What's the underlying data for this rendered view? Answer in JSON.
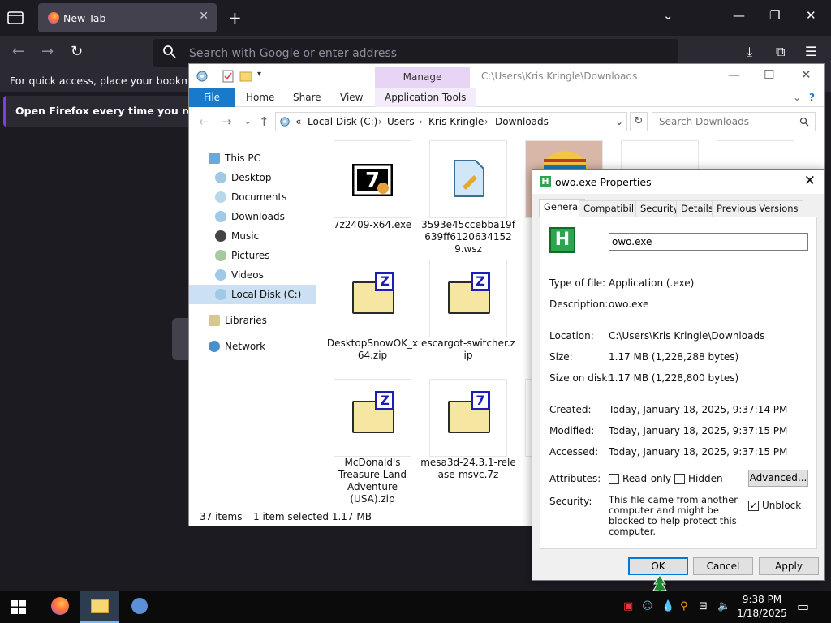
{
  "firefox": {
    "tab_title": "New Tab",
    "url_placeholder": "Search with Google or enter address",
    "bookmarks_hint": "For quick access, place your bookmarks h",
    "notice": "Open Firefox every time you restart yo",
    "accent": "#7542e5"
  },
  "explorer": {
    "manage_label": "Manage",
    "title_path": "C:\\Users\\Kris Kringle\\Downloads",
    "ribbon_tabs": [
      "File",
      "Home",
      "Share",
      "View",
      "Application Tools"
    ],
    "breadcrumb": {
      "prefix": "«",
      "parts": [
        "Local Disk (C:)",
        "Users",
        "Kris Kringle",
        "Downloads"
      ]
    },
    "search_placeholder": "Search Downloads",
    "nav": {
      "this_pc": "This PC",
      "items": [
        "Desktop",
        "Documents",
        "Downloads",
        "Music",
        "Pictures",
        "Videos",
        "Local Disk (C:)"
      ],
      "libraries": "Libraries",
      "network": "Network"
    },
    "files": [
      {
        "name": "7z2409-x64.exe"
      },
      {
        "name": "3593e45ccebba19f639ff61206341529.wsz"
      },
      {
        "name": "DesktopSnowOK_x64.zip"
      },
      {
        "name": "escargot-switcher.zip"
      },
      {
        "name": "McDonald's Treasure Land Adventure (USA).zip"
      },
      {
        "name": "mesa3d-24.3.1-release-msvc.7z"
      }
    ],
    "status": {
      "count": "37 items",
      "selected": "1 item selected  1.17 MB"
    },
    "ribbon_color": "#1979ca"
  },
  "properties": {
    "title": "owo.exe Properties",
    "tabs": [
      "General",
      "Compatibility",
      "Security",
      "Details",
      "Previous Versions"
    ],
    "filename": "owo.exe",
    "type_label": "Type of file:",
    "type_value": "Application (.exe)",
    "desc_label": "Description:",
    "desc_value": "owo.exe",
    "location_label": "Location:",
    "location_value": "C:\\Users\\Kris Kringle\\Downloads",
    "size_label": "Size:",
    "size_value": "1.17 MB (1,228,288 bytes)",
    "size_disk_label": "Size on disk:",
    "size_disk_value": "1.17 MB (1,228,800 bytes)",
    "created_label": "Created:",
    "created_value": "Today, January 18, 2025, 9:37:14 PM",
    "modified_label": "Modified:",
    "modified_value": "Today, January 18, 2025, 9:37:15 PM",
    "accessed_label": "Accessed:",
    "accessed_value": "Today, January 18, 2025, 9:37:15 PM",
    "attributes_label": "Attributes:",
    "readonly_label": "Read-only",
    "hidden_label": "Hidden",
    "advanced_label": "Advanced...",
    "security_label": "Security:",
    "security_text": "This file came from another computer and might be blocked to help protect this computer.",
    "unblock_label": "Unblock",
    "unblock_checked": true,
    "ok": "OK",
    "cancel": "Cancel",
    "apply": "Apply"
  },
  "taskbar": {
    "time": "9:38 PM",
    "date": "1/18/2025"
  }
}
